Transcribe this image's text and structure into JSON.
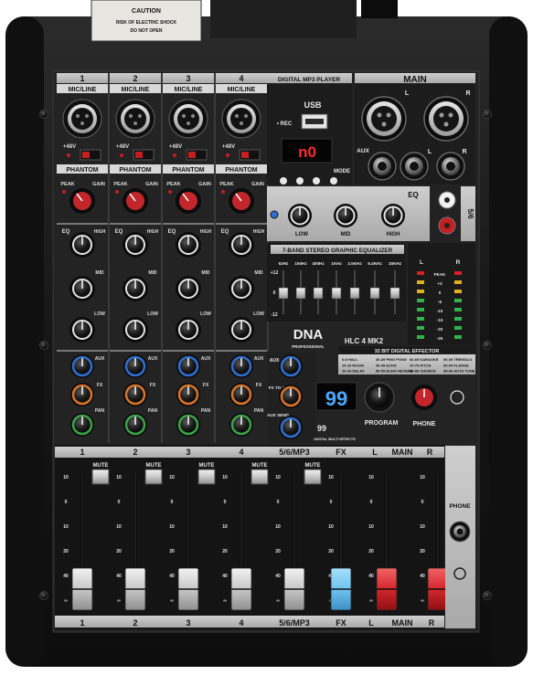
{
  "channels": [
    {
      "num": "1",
      "input": "MIC/LINE",
      "phantom": "PHANTOM",
      "plus48": "+48V"
    },
    {
      "num": "2",
      "input": "MIC/LINE",
      "phantom": "PHANTOM",
      "plus48": "+48V"
    },
    {
      "num": "3",
      "input": "MIC/LINE",
      "phantom": "PHANTOM",
      "plus48": "+48V"
    },
    {
      "num": "4",
      "input": "MIC/LINE",
      "phantom": "PHANTOM",
      "plus48": "+48V"
    }
  ],
  "strip_labels": {
    "peak": "PEAK",
    "gain": "GAIN",
    "eq": "EQ",
    "high": "HIGH",
    "mid": "MID",
    "low": "LOW",
    "aux": "AUX",
    "fx": "FX",
    "pan": "PAN"
  },
  "player": {
    "title": "DIGITAL MP3 PLAYER",
    "usb": "USB",
    "rec": "• REC",
    "display": "n0",
    "mode": "MODE"
  },
  "main_panel": {
    "title": "MAIN",
    "l": "L",
    "r": "R",
    "aux": "AUX"
  },
  "eq_panel": {
    "title": "EQ",
    "ch": "5/6",
    "mid": "MID",
    "high": "HIGH",
    "low": "LOW"
  },
  "graphic_eq": {
    "title": "7-BAND STEREO GRAPHIC EQUALIZER",
    "bands": [
      "63Hz",
      "150Hz",
      "400Hz",
      "1KHz",
      "2.5KHz",
      "6.4KHz",
      "15KHz"
    ],
    "scale": [
      "+12",
      "0",
      "-12"
    ]
  },
  "meter": {
    "l": "L",
    "r": "R",
    "labels": [
      "PEAK",
      "+3",
      "0",
      "-5",
      "-10",
      "-15",
      "-20",
      "-25"
    ]
  },
  "brand": {
    "logo": "DNA",
    "sub": "PROFESSIONAL",
    "model": "HLC 4 MK2"
  },
  "effector": {
    "title": "32 BIT DIGITAL EFFECTOR",
    "presets": [
      "0-9 HALL",
      "10-19 ROOM",
      "20-29 DELAY",
      "30-39 PING PONG",
      "40-49 ECHO",
      "50-59 ECHO REVERB",
      "60-69 KARAOKE",
      "70-79 PITCH",
      "80-89 CHORUS",
      "00-09 TREMOLO",
      "90-94 FLANGE",
      "95-99 AUTO TUNE"
    ],
    "display": "99",
    "program": "PROGRAM",
    "phone": "PHONE",
    "dsp_label": "99",
    "dsp_sub": "DIGITAL MULTI EFFECTS"
  },
  "aux_section": {
    "aux": "AUX",
    "fx_to_aux": "FX TO AUX",
    "aux_send": "AUX SEND",
    "fx_send": "FX SEND"
  },
  "faders": [
    {
      "top": "1",
      "bottom": "1",
      "mute": "MUTE",
      "cap": "grey"
    },
    {
      "top": "2",
      "bottom": "2",
      "mute": "MUTE",
      "cap": "grey"
    },
    {
      "top": "3",
      "bottom": "3",
      "mute": "MUTE",
      "cap": "grey"
    },
    {
      "top": "4",
      "bottom": "4",
      "mute": "MUTE",
      "cap": "grey"
    },
    {
      "top": "5/6/MP3",
      "bottom": "5/6/MP3",
      "mute": "MUTE",
      "cap": "grey"
    },
    {
      "top": "FX",
      "bottom": "FX",
      "mute": "",
      "cap": "blue"
    },
    {
      "top": "L",
      "bottom": "L",
      "mute": "",
      "cap": "red"
    },
    {
      "top": "R",
      "bottom": "R",
      "mute": "",
      "cap": "red"
    }
  ],
  "fader_main": {
    "top": "MAIN",
    "bottom": "MAIN"
  },
  "fader_scale": [
    "10",
    "0",
    "10",
    "20",
    "40",
    "∞"
  ],
  "phone_panel": {
    "label": "PHONE"
  },
  "caution": {
    "title": "CAUTION",
    "lines": [
      "RISK OF ELECTRIC SHOCK",
      "DO NOT OPEN"
    ]
  },
  "colors": {
    "chassis": "#1b1b1b",
    "panel": "#bdbdbd",
    "frame": "#2a2a2a",
    "knob_red": "#c2262a",
    "knob_blue": "#2f6fd0",
    "knob_orange": "#d9742a",
    "knob_green": "#3aa34a",
    "display_red": "#ff2b2b",
    "display_blue": "#4aa8ff",
    "cap_blue": "#6fc3f0",
    "cap_red": "#d4262a"
  }
}
